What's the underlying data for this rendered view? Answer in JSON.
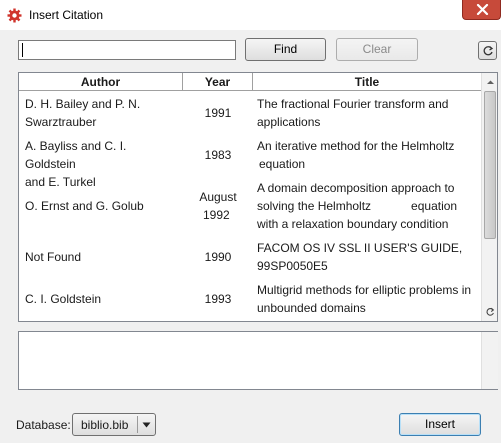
{
  "window": {
    "title": "Insert Citation"
  },
  "search": {
    "value": "",
    "placeholder": ""
  },
  "toolbar": {
    "find_label": "Find",
    "clear_label": "Clear"
  },
  "table": {
    "columns": [
      "Author",
      "Year",
      "Title"
    ],
    "rows": [
      {
        "author": [
          "D. H. Bailey and P. N.",
          "Swarztrauber"
        ],
        "year": [
          "1991"
        ],
        "title": [
          "The fractional Fourier transform and",
          "applications"
        ]
      },
      {
        "author": [
          "A. Bayliss and C. I. Goldstein",
          "and E. Turkel"
        ],
        "year": [
          "1983"
        ],
        "title": [
          "An iterative method for the Helmholtz",
          "equation"
        ]
      },
      {
        "author": [
          "O. Ernst and G. Golub"
        ],
        "year": [
          "August",
          "1992"
        ],
        "title": [
          "A domain decomposition approach to",
          "solving the Helmholtz            equation",
          "with a relaxation boundary condition"
        ]
      },
      {
        "author": [
          "Not Found"
        ],
        "year": [
          "1990"
        ],
        "title": [
          "FACOM OS IV SSL II USER'S GUIDE,",
          "99SP0050E5"
        ]
      },
      {
        "author": [
          "C. I. Goldstein"
        ],
        "year": [
          "1993"
        ],
        "title": [
          "Multigrid methods for elliptic problems in",
          "unbounded domains"
        ]
      }
    ]
  },
  "details": {
    "value": ""
  },
  "footer": {
    "database_label": "Database:",
    "database_value": "biblio.bib",
    "insert_label": "Insert"
  },
  "colors": {
    "close_button": "#c74a3a",
    "default_button_border": "#3c7fb1"
  },
  "icons": {
    "app": "gear-red-icon",
    "close": "close-icon",
    "refresh": "refresh-icon",
    "dropdown": "chevron-down-icon"
  }
}
